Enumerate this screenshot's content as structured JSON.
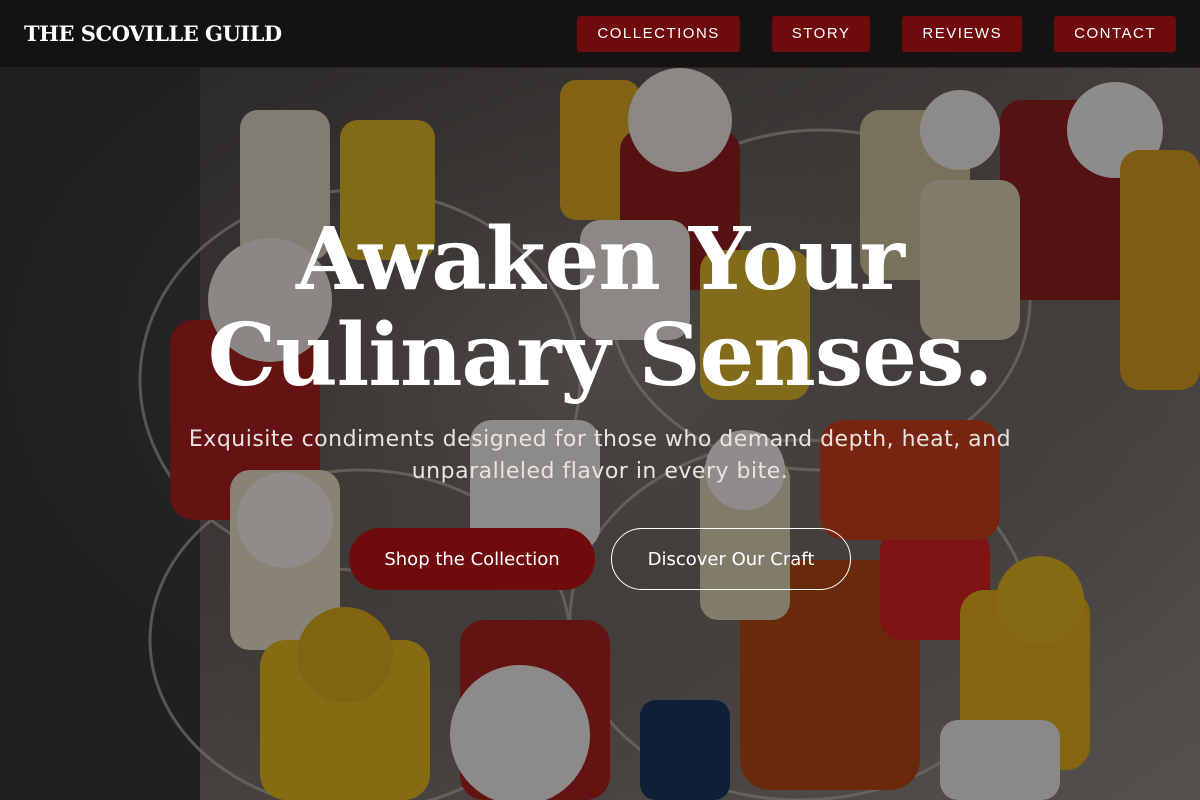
{
  "header": {
    "logo": "THE SCOVILLE GUILD",
    "nav": [
      {
        "label": "COLLECTIONS"
      },
      {
        "label": "STORY"
      },
      {
        "label": "REVIEWS"
      },
      {
        "label": "CONTACT"
      }
    ]
  },
  "hero": {
    "title_line1": "Awaken Your",
    "title_line2": "Culinary Senses.",
    "subtitle": "Exquisite condiments designed for those who demand depth, heat, and unparalleled flavor in every bite.",
    "primary_button": "Shop the Collection",
    "secondary_button": "Discover Our Craft"
  },
  "colors": {
    "accent": "#6f0b0d",
    "header_bg": "#121010",
    "text": "#ffffff"
  }
}
